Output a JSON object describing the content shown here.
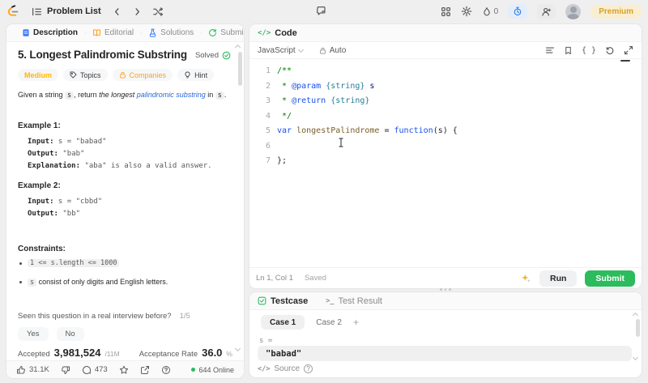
{
  "colors": {
    "accent_green": "#2cbb5d",
    "brand_amber": "#ffa116",
    "brand_blue": "#3c7cff",
    "difficulty_medium": "#ffb800",
    "link_blue": "#2d68d9"
  },
  "topbar": {
    "problem_list_label": "Problem List",
    "streak_count": "0",
    "premium_label": "Premium"
  },
  "description_panel": {
    "tabs": [
      {
        "label": "Description"
      },
      {
        "label": "Editorial"
      },
      {
        "label": "Solutions"
      },
      {
        "label": "Submissions"
      }
    ],
    "title": "5. Longest Palindromic Substring",
    "solved_label": "Solved",
    "chips": {
      "difficulty": "Medium",
      "topics": "Topics",
      "companies": "Companies",
      "hint": "Hint"
    },
    "statement": {
      "prefix": "Given a string ",
      "code_s1": "s",
      "mid1": ", return ",
      "italic_pre": "the longest ",
      "link": "palindromic substring",
      "mid2": " in ",
      "code_s2": "s",
      "suffix": "."
    },
    "example1": {
      "heading": "Example 1:",
      "input_label": "Input:",
      "input_value": " s = \"babad\"",
      "output_label": "Output:",
      "output_value": " \"bab\"",
      "explanation_label": "Explanation:",
      "explanation_value": " \"aba\" is also a valid answer."
    },
    "example2": {
      "heading": "Example 2:",
      "input_label": "Input:",
      "input_value": " s = \"cbbd\"",
      "output_label": "Output:",
      "output_value": " \"bb\""
    },
    "constraints_heading": "Constraints:",
    "constraint1": "1 <= s.length <= 1000",
    "constraint2_code": "s",
    "constraint2_text": " consist of only digits and English letters.",
    "survey": {
      "question": "Seen this question in a real interview before?",
      "progress": "1/5",
      "yes_label": "Yes",
      "no_label": "No"
    },
    "stats": {
      "accepted_label": "Accepted",
      "accepted_value": "3,981,524",
      "accepted_total": "/11M",
      "rate_label": "Acceptance Rate",
      "rate_value": "36.0",
      "rate_unit": "%"
    },
    "footer": {
      "likes": "31.1K",
      "comments": "473",
      "online": "644 Online"
    }
  },
  "editor": {
    "tab_label": "Code",
    "code_icon": "</>",
    "language": "JavaScript",
    "auto_label": "Auto",
    "braces_icon": "{ }",
    "code_lines": [
      {
        "num": "1",
        "tokens": [
          {
            "t": "/**",
            "c": "comment"
          }
        ]
      },
      {
        "num": "2",
        "tokens": [
          {
            "t": " * ",
            "c": "comment"
          },
          {
            "t": "@param",
            "c": "tag"
          },
          {
            "t": " ",
            "c": "plain"
          },
          {
            "t": "{string}",
            "c": "type"
          },
          {
            "t": " s",
            "c": "var"
          }
        ]
      },
      {
        "num": "3",
        "tokens": [
          {
            "t": " * ",
            "c": "comment"
          },
          {
            "t": "@return",
            "c": "tag"
          },
          {
            "t": " ",
            "c": "plain"
          },
          {
            "t": "{string}",
            "c": "type"
          }
        ]
      },
      {
        "num": "4",
        "tokens": [
          {
            "t": " */",
            "c": "comment"
          }
        ]
      },
      {
        "num": "5",
        "tokens": [
          {
            "t": "var",
            "c": "keyword"
          },
          {
            "t": " ",
            "c": "plain"
          },
          {
            "t": "longestPalindrome",
            "c": "func"
          },
          {
            "t": " = ",
            "c": "plain"
          },
          {
            "t": "function",
            "c": "keyword"
          },
          {
            "t": "(s) {",
            "c": "plain"
          }
        ]
      },
      {
        "num": "6",
        "tokens": []
      },
      {
        "num": "7",
        "tokens": [
          {
            "t": "};",
            "c": "plain"
          }
        ]
      }
    ],
    "status_position": "Ln 1, Col 1",
    "status_saved": "Saved",
    "run_label": "Run",
    "submit_label": "Submit"
  },
  "testcase_panel": {
    "tab_testcase": "Testcase",
    "tab_result": "Test Result",
    "terminal_icon": ">_",
    "cases": [
      {
        "label": "Case 1"
      },
      {
        "label": "Case 2"
      }
    ],
    "add_case": "+",
    "param_label": "s =",
    "param_value": "\"babad\"",
    "source_icon": "</>",
    "source_label": "Source"
  }
}
